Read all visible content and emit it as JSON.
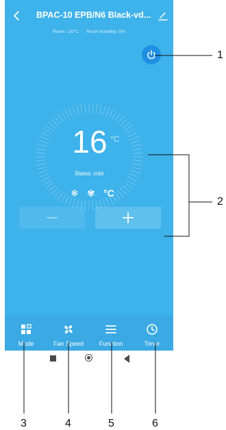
{
  "header": {
    "title": "BPAC-10 EPB/N6 Black-vd...",
    "back_icon": "chevron-left-icon",
    "edit_icon": "pencil-icon",
    "room_temp": "Room: -20°C",
    "room_humidity": "Room humidity: 0%"
  },
  "controls": {
    "temperature": "16",
    "unit": "°C",
    "status": "Status: cold",
    "mode_icons": [
      "snowflake-icon",
      "fan-icon",
      "celsius-icon"
    ],
    "mode_unit_label": "°C",
    "power_icon": "power-icon",
    "minus_icon": "minus-icon",
    "plus_icon": "plus-icon"
  },
  "bottom_nav": {
    "items": [
      {
        "label": "Mode",
        "icon": "mode-grid-icon"
      },
      {
        "label": "Fan Speed",
        "icon": "fan-icon"
      },
      {
        "label": "Function",
        "icon": "menu-icon"
      },
      {
        "label": "Timer",
        "icon": "clock-icon"
      }
    ]
  },
  "system_nav": {
    "icons": [
      "recents-square-icon",
      "home-circle-icon",
      "back-triangle-icon"
    ]
  },
  "callouts": [
    "1",
    "2",
    "3",
    "4",
    "5",
    "6"
  ],
  "colors": {
    "background": "#3eb2ea",
    "nav_bar": "#3aa9e4",
    "power_button": "#1f8fe3",
    "text": "#ffffff"
  }
}
